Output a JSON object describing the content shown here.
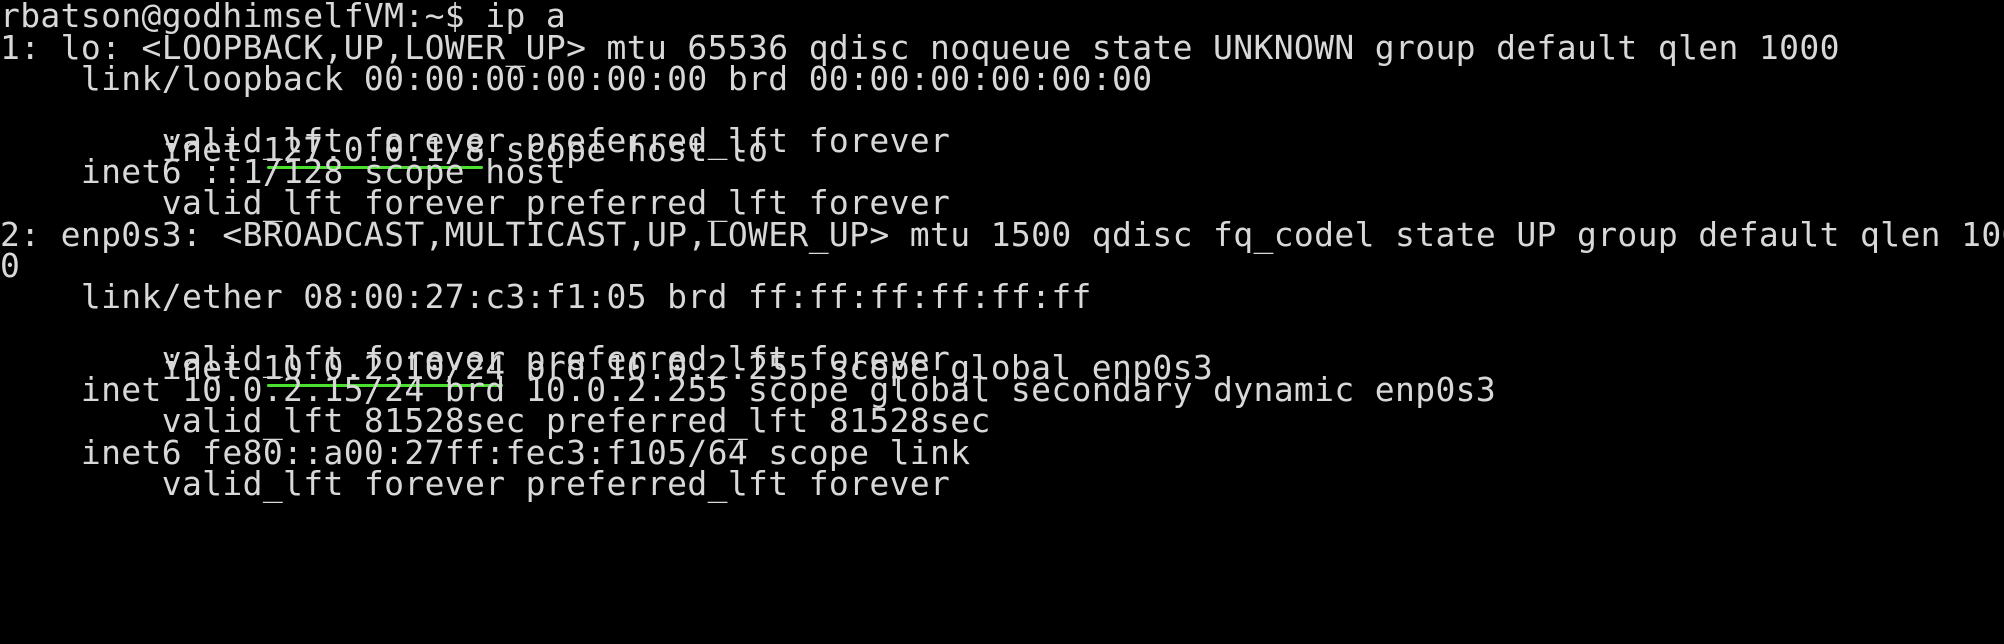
{
  "terminal": {
    "prompt_line": "rbatson@godhimselfVM:~$ ip a",
    "lines": [
      "1: lo: <LOOPBACK,UP,LOWER_UP> mtu 65536 qdisc noqueue state UNKNOWN group default qlen 1000",
      "    link/loopback 00:00:00:00:00:00 brd 00:00:00:00:00:00",
      "        valid_lft forever preferred_lft forever",
      "    inet6 ::1/128 scope host",
      "        valid_lft forever preferred_lft forever",
      "2: enp0s3: <BROADCAST,MULTICAST,UP,LOWER_UP> mtu 1500 qdisc fq_codel state UP group default qlen 100",
      "0",
      "    link/ether 08:00:27:c3:f1:05 brd ff:ff:ff:ff:ff:ff",
      "        valid_lft forever preferred_lft forever",
      "    inet 10.0.2.15/24 brd 10.0.2.255 scope global secondary dynamic enp0s3",
      "        valid_lft 81528sec preferred_lft 81528sec",
      "    inet6 fe80::a00:27ff:fec3:f105/64 scope link",
      "        valid_lft forever preferred_lft forever"
    ],
    "loopback_inet": {
      "prefix": "    inet ",
      "address": "127.0.0.1/8",
      "suffix": " scope host lo"
    },
    "enp0s3_inet": {
      "prefix": "    inet ",
      "address": "10.0.2.10/24",
      "suffix": " brd 10.0.2.255 scope global enp0s3"
    }
  },
  "colors": {
    "background": "#000000",
    "text": "#d8d8d8",
    "underline": "#4be02f"
  }
}
